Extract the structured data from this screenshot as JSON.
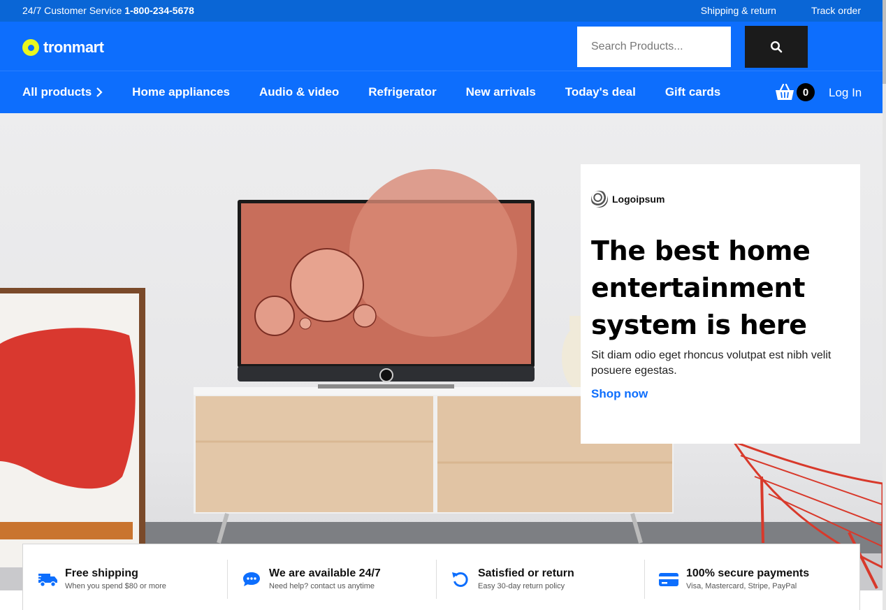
{
  "topbar": {
    "service_label": "24/7 Customer Service",
    "phone": "1-800-234-5678",
    "shipping_link": "Shipping & return",
    "track_link": "Track order"
  },
  "header": {
    "brand": "tronmart",
    "search_placeholder": "Search Products...",
    "brand_color": "#0d6efd",
    "logo_color": "#e9f71e"
  },
  "nav": {
    "items": [
      {
        "label": "All products"
      },
      {
        "label": "Home appliances"
      },
      {
        "label": "Audio & video"
      },
      {
        "label": "Refrigerator"
      },
      {
        "label": "New arrivals"
      },
      {
        "label": "Today's deal"
      },
      {
        "label": "Gift cards"
      }
    ],
    "cart_count": "0",
    "login": "Log In"
  },
  "hero": {
    "partner_logo": "Logoipsum",
    "headline": "The best home entertainment system is here",
    "description": "Sit diam odio eget rhoncus volutpat est nibh velit posuere egestas.",
    "cta": "Shop now"
  },
  "features": [
    {
      "icon": "truck-icon",
      "title": "Free shipping",
      "subtitle": "When you spend $80 or more"
    },
    {
      "icon": "chat-icon",
      "title": "We are available 24/7",
      "subtitle": "Need help? contact us anytime"
    },
    {
      "icon": "return-icon",
      "title": "Satisfied or return",
      "subtitle": "Easy 30-day return policy"
    },
    {
      "icon": "credit-card-icon",
      "title": "100% secure payments",
      "subtitle": "Visa, Mastercard, Stripe, PayPal"
    }
  ]
}
